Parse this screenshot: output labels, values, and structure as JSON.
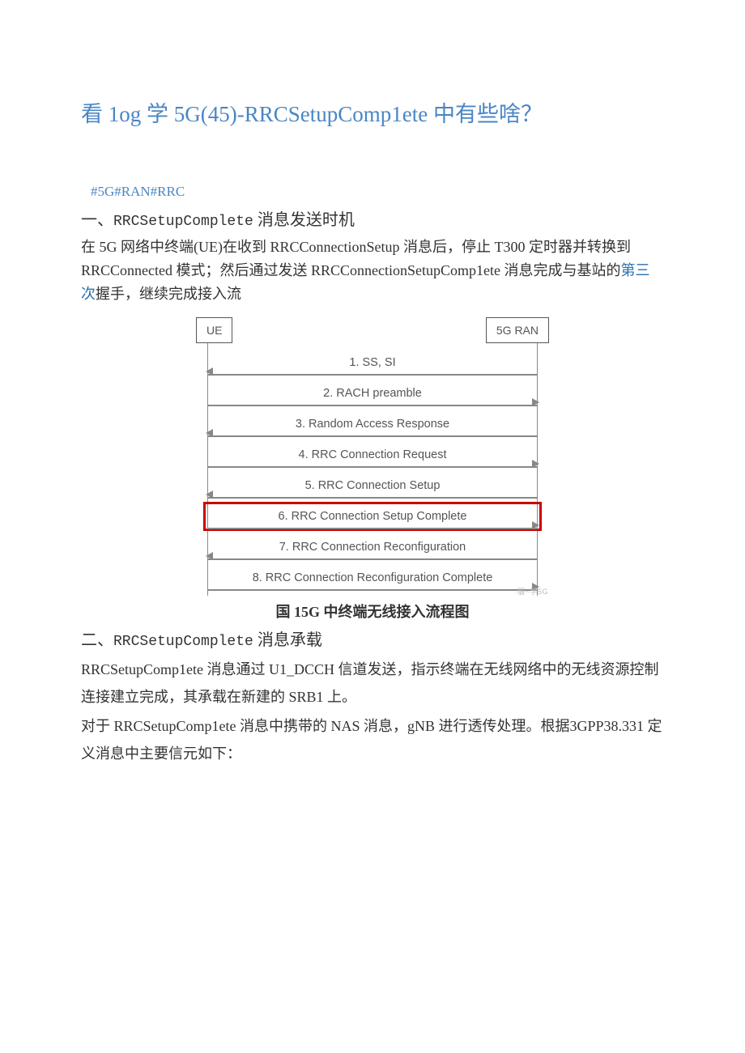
{
  "title": "看 1og 学 5G(45)-RRCSetupComp1ete 中有些啥？",
  "tags": "#5G#RAN#RRC",
  "section1": {
    "heading_num": "一、",
    "heading_code": "RRCSetupComplete",
    "heading_tail": " 消息发送时机",
    "p1a": "在 5G 网络中终端(UE)在收到 RRCConnectionSetup 消息后，停止 T300 定时器并转换到 RRCConnected 模式；然后通过发送 RRCConnectionSetupComp1ete 消息完成与基站的",
    "p1_link": "第三次",
    "p1b": "握手，继续完成接入流"
  },
  "diagram": {
    "left_label": "UE",
    "right_label": "5G RAN",
    "steps": [
      {
        "label": "1. SS, SI",
        "dir": "L"
      },
      {
        "label": "2. RACH preamble",
        "dir": "R"
      },
      {
        "label": "3. Random Access Response",
        "dir": "L"
      },
      {
        "label": "4. RRC Connection Request",
        "dir": "R"
      },
      {
        "label": "5. RRC Connection Setup",
        "dir": "L"
      },
      {
        "label": "6. RRC Connection Setup Complete",
        "dir": "R",
        "highlight": true
      },
      {
        "label": "7. RRC Connection Reconfiguration",
        "dir": "L"
      },
      {
        "label": "8. RRC Connection Reconfiguration Complete",
        "dir": "R"
      }
    ],
    "watermark": "·服~学5G",
    "caption": "国 15G 中终端无线接入流程图"
  },
  "section2": {
    "heading_num": "二、",
    "heading_code": "RRCSetupComplete",
    "heading_tail": " 消息承载",
    "p1": "RRCSetupComp1ete 消息通过 U1_DCCH 信道发送，指示终端在无线网络中的无线资源控制连接建立完成，其承载在新建的 SRB1 上。",
    "p2": "对于 RRCSetupComp1ete 消息中携带的 NAS 消息，gNB 进行透传处理。根据3GPP38.331 定义消息中主要信元如下："
  }
}
